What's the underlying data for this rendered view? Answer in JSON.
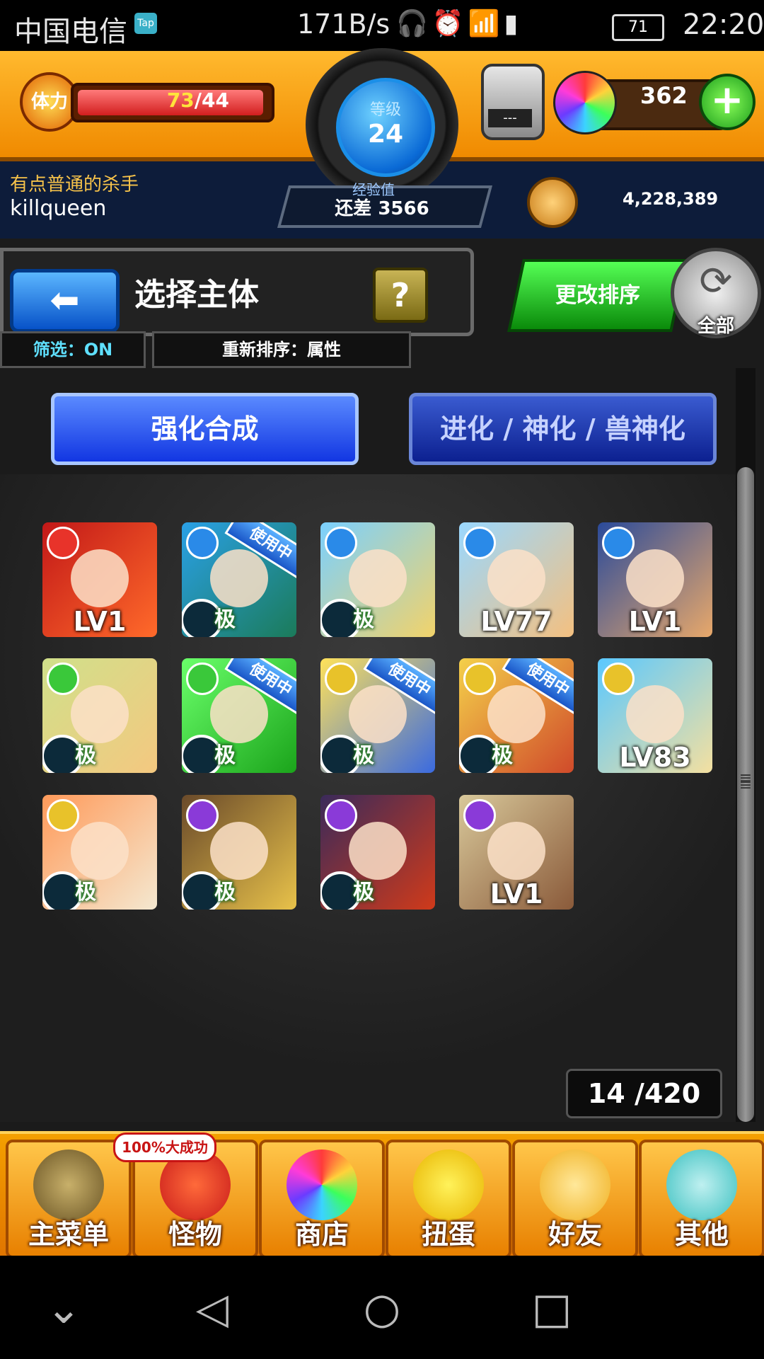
{
  "status_bar": {
    "carrier": "中国电信",
    "tap_badge": "Tap",
    "network_speed": "171B/s",
    "battery": "71",
    "time": "22:20"
  },
  "header": {
    "stamina_label": "体力",
    "stamina_current": "73",
    "stamina_max": "/44",
    "stamina_fraction": 1.0,
    "rank_label": "等级",
    "rank_value": "24",
    "exp_label": "经验值",
    "exp_remaining": "还差 3566",
    "gacha_placeholder": "---",
    "orb_count": "362",
    "nickname": "有点普通的杀手",
    "username": "killqueen",
    "gold": "4,228,389"
  },
  "title_area": {
    "title": "选择主体",
    "help": "?",
    "filter": "筛选：ON",
    "sort": "重新排序：属性",
    "change_sort": "更改排序",
    "all": "全部"
  },
  "tabs": {
    "active": "强化合成",
    "inactive": "进化 / 神化 / 兽神化"
  },
  "monsters": [
    {
      "element": "fire",
      "label": "LV1",
      "in_use": false,
      "colors": [
        "#c21818",
        "#ff6a2a"
      ]
    },
    {
      "element": "water",
      "label": "极",
      "in_use": true,
      "colors": [
        "#2aa0e6",
        "#1b7b5a"
      ]
    },
    {
      "element": "water",
      "label": "极",
      "in_use": false,
      "colors": [
        "#7ad0ff",
        "#f2d36a"
      ]
    },
    {
      "element": "water",
      "label": "LV77",
      "in_use": false,
      "colors": [
        "#9ad8ff",
        "#f4c080"
      ]
    },
    {
      "element": "water",
      "label": "LV1",
      "in_use": false,
      "colors": [
        "#2a4a9a",
        "#e8a86a"
      ]
    },
    {
      "element": "wood",
      "label": "极",
      "in_use": false,
      "colors": [
        "#d0e08a",
        "#f4c880"
      ]
    },
    {
      "element": "wood",
      "label": "极",
      "in_use": true,
      "colors": [
        "#6aff6a",
        "#1ba41b"
      ]
    },
    {
      "element": "light",
      "label": "极",
      "in_use": true,
      "colors": [
        "#ffe25a",
        "#3a6ae0"
      ]
    },
    {
      "element": "light",
      "label": "极",
      "in_use": true,
      "colors": [
        "#f4d04a",
        "#d04a2a"
      ]
    },
    {
      "element": "light",
      "label": "LV83",
      "in_use": false,
      "colors": [
        "#5ac8ff",
        "#f4e0a0"
      ]
    },
    {
      "element": "light",
      "label": "极",
      "in_use": false,
      "colors": [
        "#ff9a5a",
        "#f4e8d0"
      ]
    },
    {
      "element": "dark",
      "label": "极",
      "in_use": false,
      "colors": [
        "#6a4a2a",
        "#e8c24a"
      ]
    },
    {
      "element": "dark",
      "label": "极",
      "in_use": false,
      "colors": [
        "#3a2a5a",
        "#d03a1a"
      ]
    },
    {
      "element": "dark",
      "label": "LV1",
      "in_use": false,
      "colors": [
        "#d8c89a",
        "#8a5a3a"
      ]
    }
  ],
  "in_use_label": "使用中",
  "count": "14 /420",
  "bottom_nav": [
    {
      "label": "主菜单",
      "icon": "gate-icon"
    },
    {
      "label": "怪物",
      "icon": "monster-icon"
    },
    {
      "label": "商店",
      "icon": "orb-icon"
    },
    {
      "label": "扭蛋",
      "icon": "egg-icon"
    },
    {
      "label": "好友",
      "icon": "friends-icon"
    },
    {
      "label": "其他",
      "icon": "other-icon"
    }
  ],
  "promo_badge": "100%大成功",
  "element_colors": {
    "fire": "#e8332a",
    "water": "#2a8ae8",
    "wood": "#3ac83a",
    "light": "#e8c22a",
    "dark": "#8a3ad8"
  }
}
